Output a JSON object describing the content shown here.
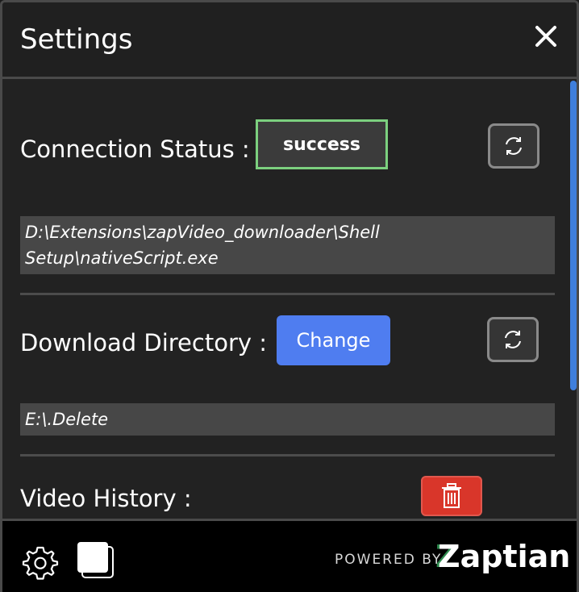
{
  "header": {
    "title": "Settings",
    "close_icon": "close-icon"
  },
  "connection": {
    "label": "Connection Status :",
    "status": "success",
    "status_color": "#7cd07f",
    "path_line1": "D:\\Extensions\\zapVideo_downloader\\Shell",
    "path_line2": "Setup\\nativeScript.exe"
  },
  "download": {
    "label": "Download Directory :",
    "change_label": "Change",
    "accent": "#4f7df0",
    "path": "E:\\.Delete"
  },
  "history": {
    "label": "Video History :",
    "delete_color": "#d9362a"
  },
  "footer": {
    "powered_by": "POWERED BY",
    "brand_first": "Z",
    "brand_rest": "aptian",
    "brand_accent": "#2e8b4f"
  },
  "icons": {
    "refresh": "refresh-icon",
    "trash": "trash-icon",
    "gear": "gear-icon",
    "copy": "copy-icon"
  }
}
